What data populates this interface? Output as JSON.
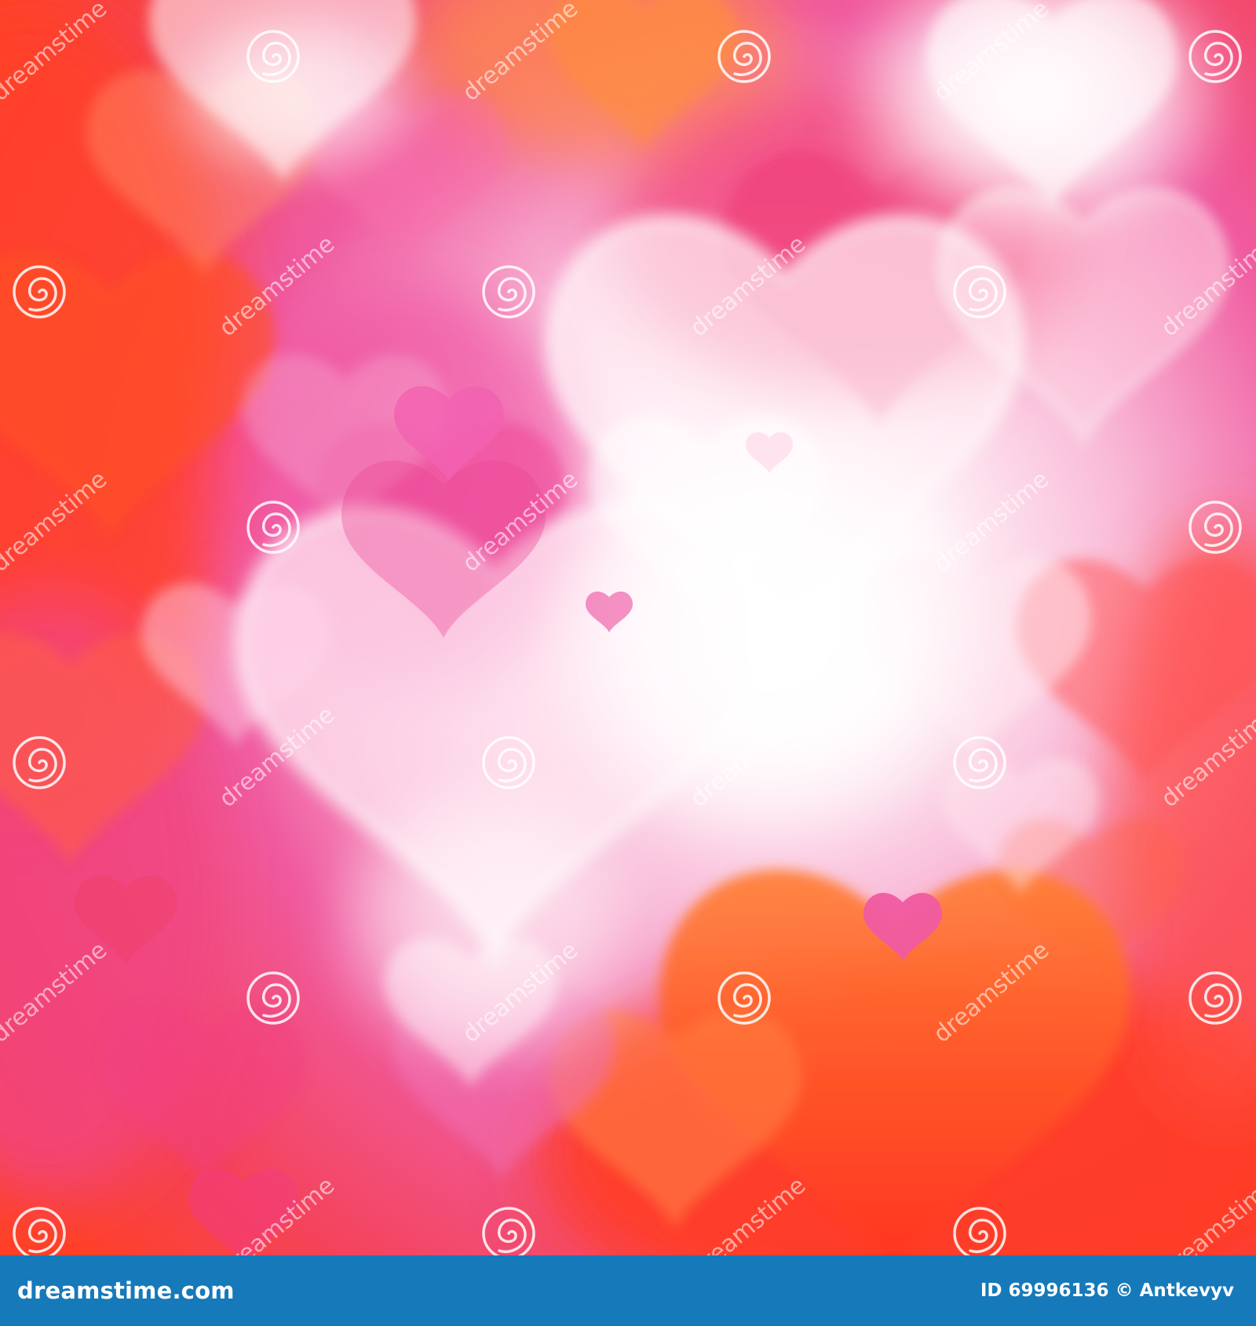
{
  "image": {
    "subject": "pink and red bokeh hearts background",
    "watermark_text": "dreamstime",
    "icons": [
      "spiral-watermark-icon"
    ],
    "colors": {
      "hot_red": "#ff2a1e",
      "orange": "#ff6a22",
      "magenta_pink": "#f0449a",
      "light_pink": "#f7b6d4",
      "glow_white": "#ffffff",
      "footer_blue": "#1679ba"
    }
  },
  "footer": {
    "logo": "dreamstime.com",
    "id_text": "ID 69996136",
    "credit_text": "© Antkevyv"
  }
}
